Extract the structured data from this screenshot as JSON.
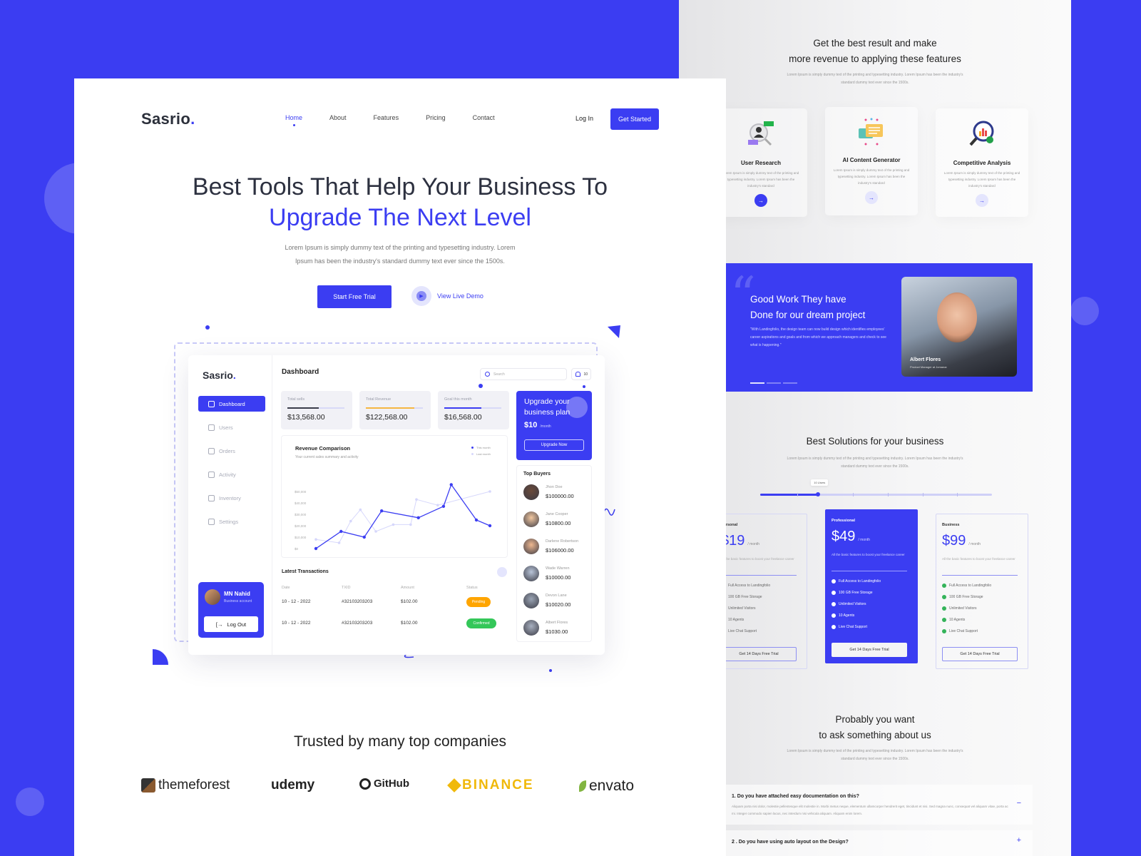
{
  "colors": {
    "accent": "#3b3df2",
    "pending": "#ffa500",
    "confirmed": "#34c759",
    "text": "#2d3140"
  },
  "nav": {
    "logo": "Sasrio",
    "logo_dot": ".",
    "links": [
      "Home",
      "About",
      "Features",
      "Pricing",
      "Contact"
    ],
    "active": "Home",
    "login": "Log In",
    "cta": "Get Started"
  },
  "hero": {
    "title_line1": "Best Tools That Help Your Business To",
    "title_line2": "Upgrade The Next Level",
    "desc_line1": "Lorem Ipsum is simply dummy text of the printing and typesetting industry. Lorem",
    "desc_line2": "Ipsum has been the industry's standard dummy text ever since the 1500s.",
    "primary_btn": "Start Free Trial",
    "demo_btn": "View Live Demo"
  },
  "dashboard": {
    "logo": "Sasrio",
    "logo_dot": ".",
    "title": "Dashboard",
    "search_placeholder": "Search",
    "notifications": "10",
    "sidebar": [
      {
        "label": "Dashboard",
        "icon": "gauge-icon",
        "active": true
      },
      {
        "label": "Users",
        "icon": "users-icon"
      },
      {
        "label": "Orders",
        "icon": "cart-icon"
      },
      {
        "label": "Activity",
        "icon": "bar-chart-icon"
      },
      {
        "label": "Inventory",
        "icon": "document-icon"
      },
      {
        "label": "Settings",
        "icon": "gear-icon"
      }
    ],
    "user": {
      "name": "MN Nahid",
      "role": "Business account",
      "logout": "Log Out"
    },
    "stats": [
      {
        "label": "Total sells",
        "value": "$13,568.00",
        "progress": 0.55,
        "color": "#3a3d4a"
      },
      {
        "label": "Total Revenue",
        "value": "$122,568.00",
        "progress": 0.85,
        "color": "#f5b642"
      },
      {
        "label": "Goal this month",
        "value": "$16,568.00",
        "progress": 0.65,
        "color": "#3b3df2"
      }
    ],
    "upgrade": {
      "title": "Upgrade your business plan",
      "price": "$10",
      "period": "/month",
      "button": "Upgrade Now"
    },
    "chart": {
      "title": "Revenue Comparison",
      "subtitle": "Your current sales summary and activity",
      "legend": [
        "This month",
        "Last month"
      ]
    },
    "transactions": {
      "title": "Latest Transactions",
      "headers": [
        "Date",
        "TXID",
        "Amount",
        "Status"
      ],
      "rows": [
        {
          "date": "10 - 12 - 2022",
          "txid": "#32103203203",
          "amount": "$102.00",
          "status": "Pending"
        },
        {
          "date": "10 - 12 - 2022",
          "txid": "#32103203203",
          "amount": "$102.00",
          "status": "Confirmed"
        }
      ]
    },
    "buyers": {
      "title": "Top Buyers",
      "list": [
        {
          "name": "Jhon Doe",
          "amount": "$100000.00"
        },
        {
          "name": "Jane Cooper",
          "amount": "$10800.00"
        },
        {
          "name": "Darlene Robertson",
          "amount": "$106000.00"
        },
        {
          "name": "Wade Warren",
          "amount": "$10000.00"
        },
        {
          "name": "Devon Lane",
          "amount": "$10020.00"
        },
        {
          "name": "Albert Flores",
          "amount": "$1030.00"
        }
      ]
    }
  },
  "chart_data": {
    "type": "line",
    "title": "Revenue Comparison",
    "subtitle": "Your current sales summary and activity",
    "xlabel": "",
    "ylabel": "",
    "yticks": [
      "$0",
      "$10,000",
      "$20,000",
      "$30,000",
      "$40,000",
      "$50,000"
    ],
    "ylim": [
      0,
      60000
    ],
    "legend_position": "top-right",
    "x": [
      1,
      2,
      3,
      4,
      5,
      6,
      7,
      8,
      9,
      10
    ],
    "series": [
      {
        "name": "This month",
        "color": "#3b3df2",
        "x": [
          1,
          2.3,
          3.5,
          4.4,
          6.3,
          7.6,
          8,
          9.3,
          10
        ],
        "values": [
          0,
          15000,
          10000,
          33000,
          27000,
          37000,
          56000,
          25000,
          20000
        ]
      },
      {
        "name": "Last month",
        "color": "#d6d7fb",
        "x": [
          1,
          2.2,
          2.8,
          3.3,
          4.1,
          5,
          5.9,
          6.2,
          7.3,
          10
        ],
        "values": [
          8000,
          5000,
          24000,
          34000,
          15000,
          21000,
          21000,
          43000,
          38000,
          50000
        ]
      }
    ]
  },
  "trusted": {
    "title": "Trusted by many top companies",
    "logos": [
      "themeforest",
      "udemy",
      "GitHub",
      "BINANCE",
      "envato"
    ]
  },
  "features": {
    "title_line1": "Get the best result and make",
    "title_line2": "more revenue to applying these features",
    "desc": "Lorem Ipsum is simply dummy text of the printing and typesetting industry. Lorem Ipsum has been the industry's standard dummy text ever since the 1500s.",
    "cards": [
      {
        "title": "User Research",
        "desc": "Lorem Ipsum is simply dummy text of the printing and typesetting industry. Lorem Ipsum has been the industry's standard"
      },
      {
        "title": "AI Content Generator",
        "desc": "Lorem Ipsum is simply dummy text of the printing and typesetting industry. Lorem Ipsum has been the industry's standard"
      },
      {
        "title": "Competitive Analysis",
        "desc": "Lorem Ipsum is simply dummy text of the printing and typesetting industry. Lorem Ipsum has been the industry's standard"
      }
    ]
  },
  "testimonial": {
    "title_line1": "Good Work They have",
    "title_line2": "Done for our dream project",
    "quote": "\"With Landingfolio, the design team can now build design which identifies employees' career aspirations and goals and from which we approach managers and check to see what is happening.\"",
    "name": "Albert Flores",
    "role": "Product Manager at Jomanar",
    "active_slide": 1,
    "slides": 3
  },
  "pricing": {
    "title": "Best Solutions for your business",
    "desc": "Lorem Ipsum is simply dummy text of the printing and typesetting industry. Lorem Ipsum has been the industry's standard dummy text ever since the 1500s.",
    "slider_label": "10 Users",
    "slider_value": 0.25,
    "plans": [
      {
        "name": "Personal",
        "price": "$19",
        "period": "/ month",
        "desc": "All the basic features to boost your freelance career",
        "features": [
          "Full Access to Landingfolio",
          "100 GB Free Storage",
          "Unlimited Visitors",
          "10 Agents",
          "Live Chat Support"
        ],
        "cta": "Get 14 Days Free Trial"
      },
      {
        "name": "Professional",
        "price": "$49",
        "period": "/ month",
        "desc": "All the basic features to boost your freelance career",
        "features": [
          "Full Access to Landingfolio",
          "100 GB Free Storage",
          "Unlimited Visitors",
          "10 Agents",
          "Live Chat Support"
        ],
        "cta": "Get 14 Days Free Trial"
      },
      {
        "name": "Business",
        "price": "$99",
        "period": "/ month",
        "desc": "All the basic features to boost your freelance career",
        "features": [
          "Full Access to Landingfolio",
          "100 GB Free Storage",
          "Unlimited Visitors",
          "10 Agents",
          "Live Chat Support"
        ],
        "cta": "Get 14 Days Free Trial"
      }
    ]
  },
  "faq": {
    "title_line1": "Probably you want",
    "title_line2": "to ask something about us",
    "desc": "Lorem Ipsum is simply dummy text of the printing and typesetting industry. Lorem Ipsum has been the industry's standard dummy text ever since the 1500s.",
    "items": [
      {
        "q": "1. Do you have attached easy documentation on this?",
        "a": "Aliquam porta nisi dolor, molestie pellentesque elit molestie in. Morbi metus neque, elementum ullamcorper hendrerit eget, tincidunt et nisi. Sed magna nunc, consequat vel aliquam vitae, porta ac mi. Integer commodo sapien lacus, nec interdum nisi vehicula aliquam. Aliquam enim lorem.",
        "open": true,
        "toggle": "−"
      },
      {
        "q": "2 . Do you have using auto layout on the Design?",
        "toggle": "+"
      }
    ]
  }
}
